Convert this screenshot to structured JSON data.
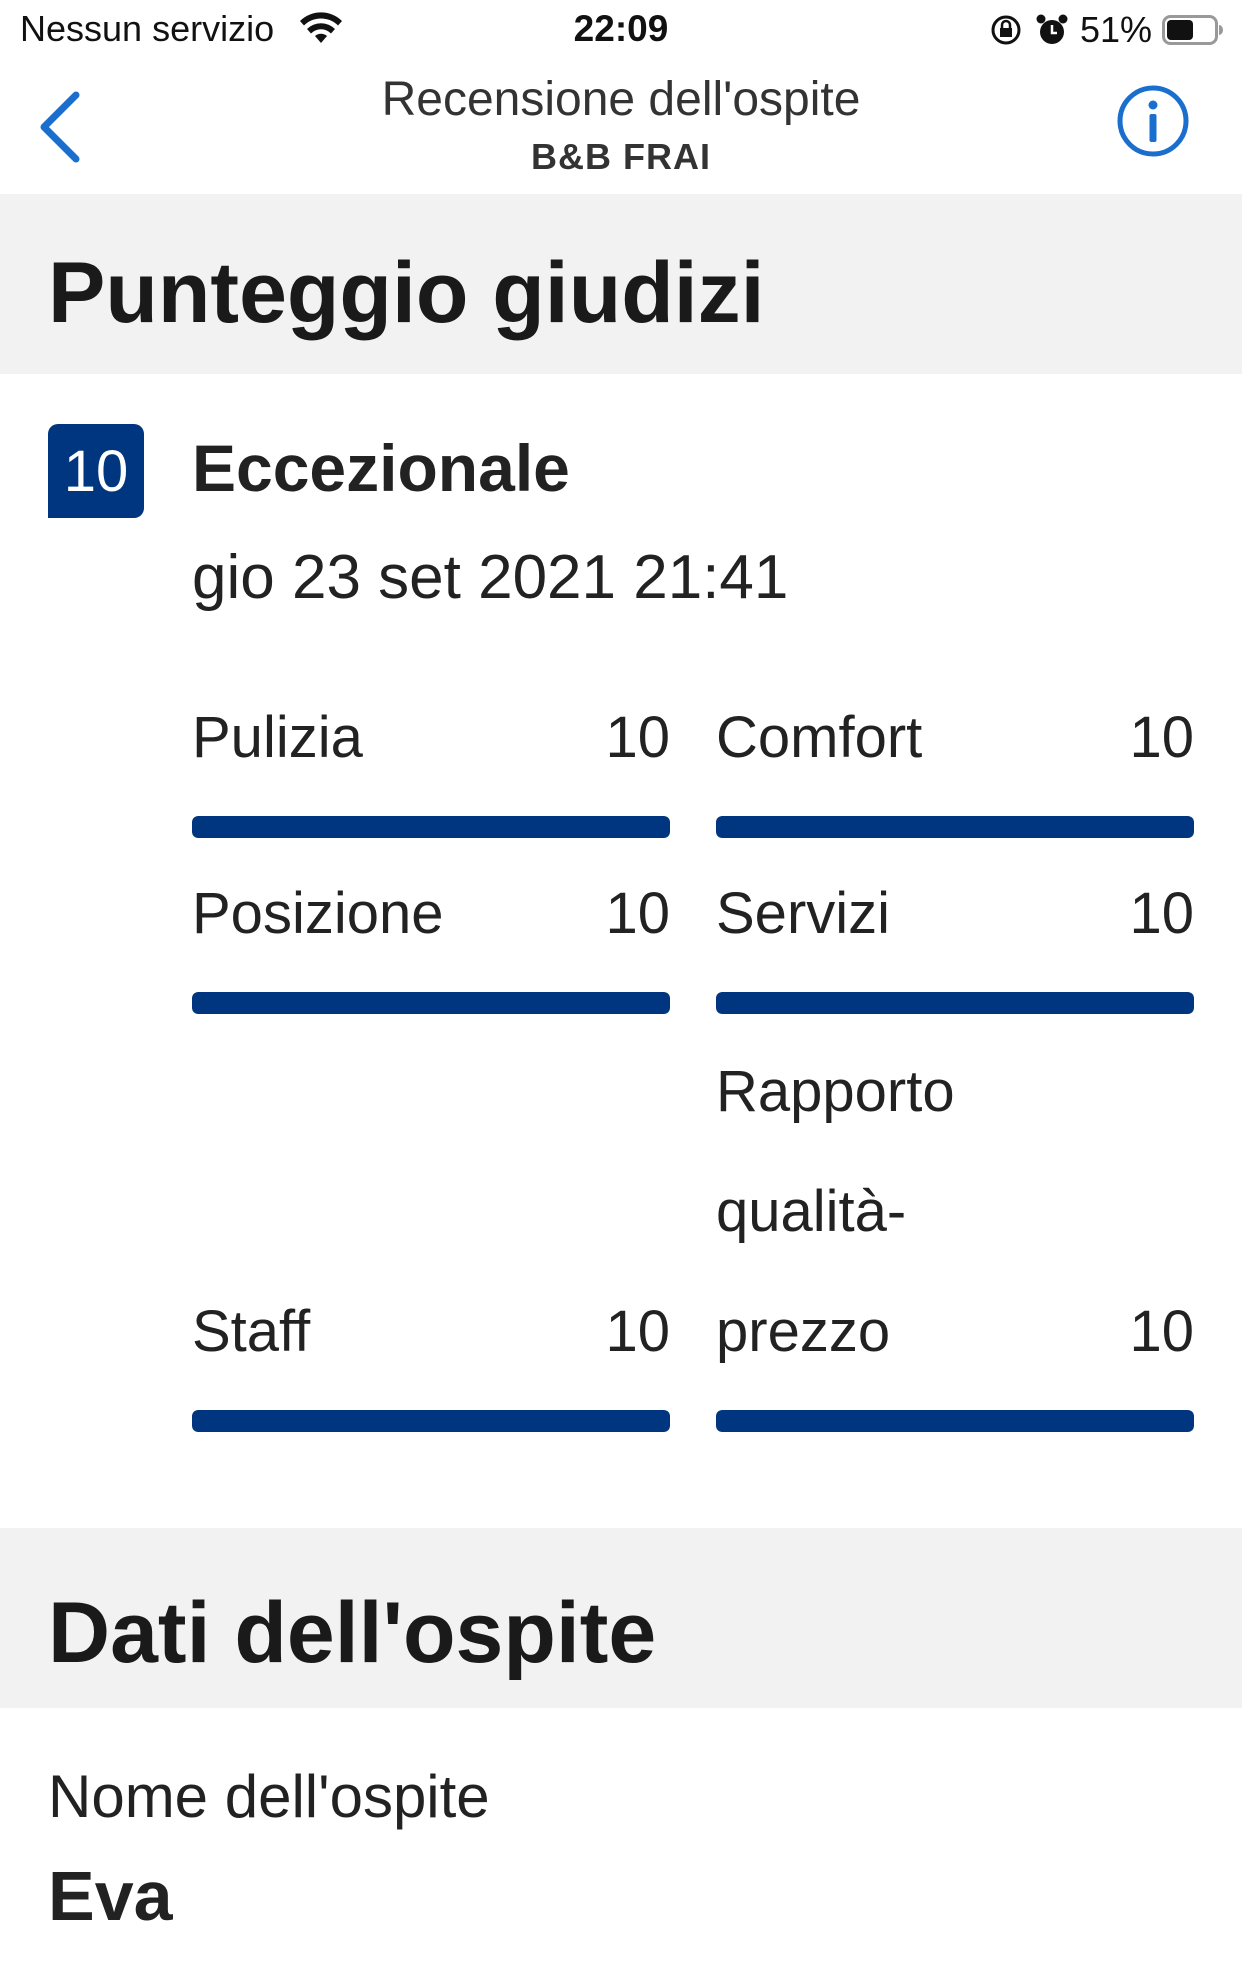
{
  "status_bar": {
    "carrier": "Nessun servizio",
    "time": "22:09",
    "battery": "51%"
  },
  "nav": {
    "title": "Recensione dell'ospite",
    "subtitle": "B&B FRAI",
    "accent_color": "#1a6fce"
  },
  "scores_section": {
    "title": "Punteggio giudizi",
    "overall_score": "10",
    "overall_label": "Eccezionale",
    "date": "gio 23 set 2021 21:41",
    "bar_color": "#003580",
    "categories": [
      {
        "label": "Pulizia",
        "value": "10",
        "fill": 1.0
      },
      {
        "label": "Comfort",
        "value": "10",
        "fill": 1.0
      },
      {
        "label": "Posizione",
        "value": "10",
        "fill": 1.0
      },
      {
        "label": "Servizi",
        "value": "10",
        "fill": 1.0
      },
      {
        "label": "Staff",
        "value": "10",
        "fill": 1.0
      },
      {
        "label": "Rapporto qualità-prezzo",
        "value": "10",
        "fill": 1.0
      }
    ]
  },
  "guest_section": {
    "title": "Dati dell'ospite",
    "name_label": "Nome dell'ospite",
    "name_value": "Eva"
  }
}
